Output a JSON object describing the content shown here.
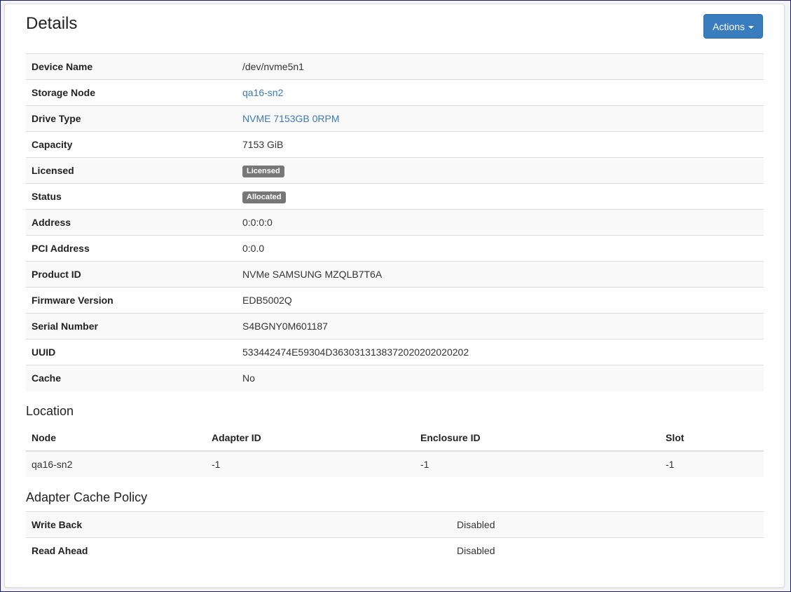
{
  "page": {
    "title": "Details",
    "actions_label": "Actions"
  },
  "details": [
    {
      "key": "Device Name",
      "value": "/dev/nvme5n1",
      "kind": "text"
    },
    {
      "key": "Storage Node",
      "value": "qa16-sn2",
      "kind": "link"
    },
    {
      "key": "Drive Type",
      "value": "NVME 7153GB 0RPM",
      "kind": "link"
    },
    {
      "key": "Capacity",
      "value": "7153 GiB",
      "kind": "text"
    },
    {
      "key": "Licensed",
      "value": "Licensed",
      "kind": "badge"
    },
    {
      "key": "Status",
      "value": "Allocated",
      "kind": "badge"
    },
    {
      "key": "Address",
      "value": "0:0:0:0",
      "kind": "text"
    },
    {
      "key": "PCI Address",
      "value": "0:0.0",
      "kind": "text"
    },
    {
      "key": "Product ID",
      "value": "NVMe SAMSUNG MZQLB7T6A",
      "kind": "text"
    },
    {
      "key": "Firmware Version",
      "value": "EDB5002Q",
      "kind": "text"
    },
    {
      "key": "Serial Number",
      "value": "S4BGNY0M601187",
      "kind": "text"
    },
    {
      "key": "UUID",
      "value": "533442474E59304D3630313138372020202020202",
      "kind": "text"
    },
    {
      "key": "Cache",
      "value": "No",
      "kind": "text"
    }
  ],
  "location": {
    "title": "Location",
    "headers": [
      "Node",
      "Adapter ID",
      "Enclosure ID",
      "Slot"
    ],
    "rows": [
      [
        "qa16-sn2",
        "-1",
        "-1",
        "-1"
      ]
    ]
  },
  "adapter_cache": {
    "title": "Adapter Cache Policy",
    "rows": [
      {
        "key": "Write Back",
        "value": "Disabled"
      },
      {
        "key": "Read Ahead",
        "value": "Disabled"
      }
    ]
  },
  "colors": {
    "primary": "#3a7dbf",
    "link": "#3a7ab6",
    "badge": "#777777"
  }
}
